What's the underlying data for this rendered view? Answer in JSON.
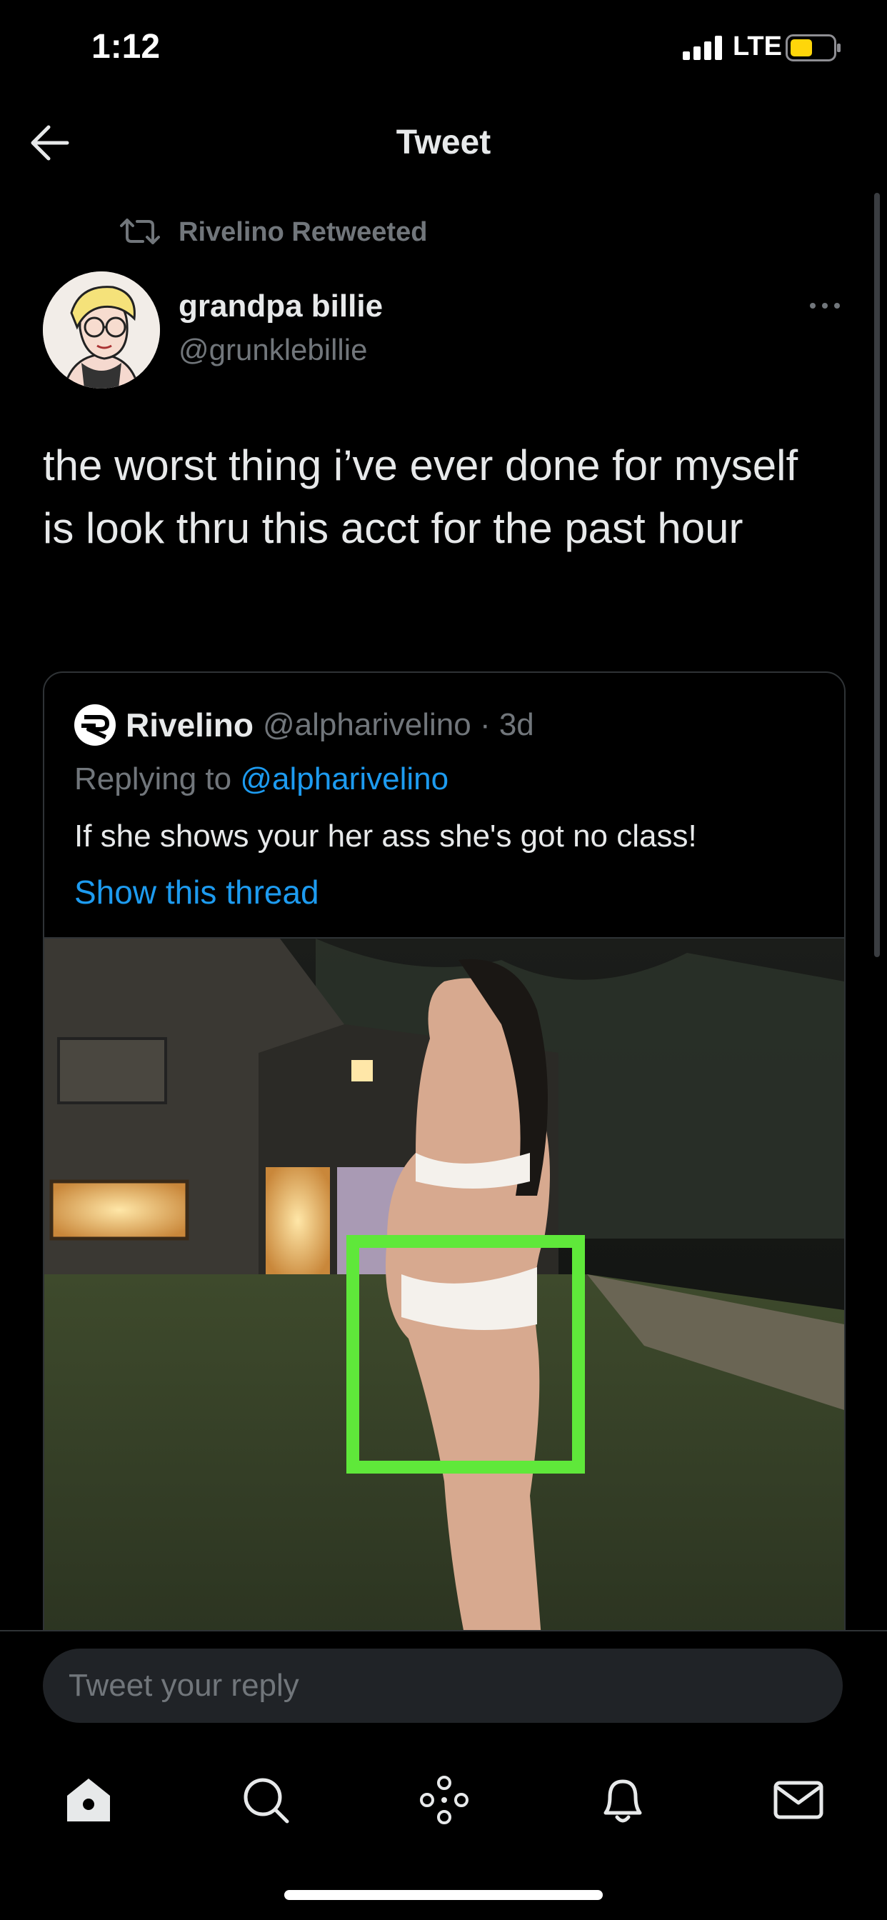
{
  "status_bar": {
    "time": "1:12",
    "network": "LTE"
  },
  "nav": {
    "title": "Tweet"
  },
  "retweet": {
    "text": "Rivelino Retweeted"
  },
  "tweet": {
    "author_name": "grandpa billie",
    "author_handle": "@grunklebillie",
    "text": "the worst thing i’ve ever done for myself is look thru this acct for the past hour"
  },
  "quoted_tweet": {
    "author_name": "Rivelino",
    "meta": "@alpharivelino · 3d",
    "replying_prefix": "Replying to ",
    "replying_mention": "@alpharivelino",
    "text": "If she shows your her ass she's got no class!",
    "show_thread": "Show this thread"
  },
  "reply": {
    "placeholder": "Tweet your reply"
  },
  "tabs": [
    "home-icon",
    "search-icon",
    "spaces-icon",
    "notifications-icon",
    "messages-icon"
  ],
  "colors": {
    "accent": "#1d9bf0",
    "highlight_box": "#5fe83a",
    "secondary_text": "#71767b"
  }
}
